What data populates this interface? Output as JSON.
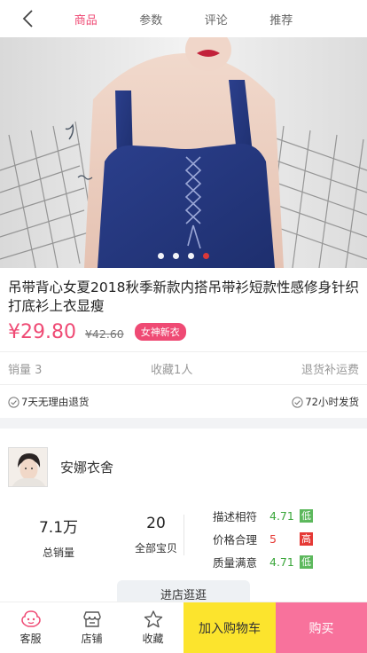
{
  "nav": {
    "tabs": [
      {
        "label": "商品",
        "active": true
      },
      {
        "label": "参数",
        "active": false
      },
      {
        "label": "评论",
        "active": false
      },
      {
        "label": "推荐",
        "active": false
      }
    ],
    "accent_color": "#ef4a74"
  },
  "carousel": {
    "dot_count": 4,
    "active_index": 3
  },
  "product": {
    "title": "吊带背心女夏2018秋季新款内搭吊带衫短款性感修身针织打底衫上衣显瘦",
    "price": "¥29.80",
    "old_price": "¥42.60",
    "tag": "女神新衣"
  },
  "stats": {
    "sales": "销量 3",
    "favorites": "收藏1人",
    "shipping": "退货补运费"
  },
  "services": {
    "left": "7天无理由退货",
    "right": "72小时发货"
  },
  "shop": {
    "name": "安娜衣舍",
    "metrics": [
      {
        "value": "7.1万",
        "label": "总销量"
      },
      {
        "value": "20",
        "label": "全部宝贝"
      }
    ],
    "ratings": [
      {
        "name": "描述相符",
        "score": "4.71",
        "level": "低",
        "score_color": "#3aa63a",
        "badge_color": "#5cb85c"
      },
      {
        "name": "价格合理",
        "score": "5",
        "level": "高",
        "score_color": "#e53935",
        "badge_color": "#e53935"
      },
      {
        "name": "质量满意",
        "score": "4.71",
        "level": "低",
        "score_color": "#3aa63a",
        "badge_color": "#5cb85c"
      }
    ],
    "enter_label": "进店逛逛"
  },
  "bottombar": {
    "service": "客服",
    "store": "店铺",
    "favorite": "收藏",
    "add_cart": "加入购物车",
    "buy": "购买"
  }
}
